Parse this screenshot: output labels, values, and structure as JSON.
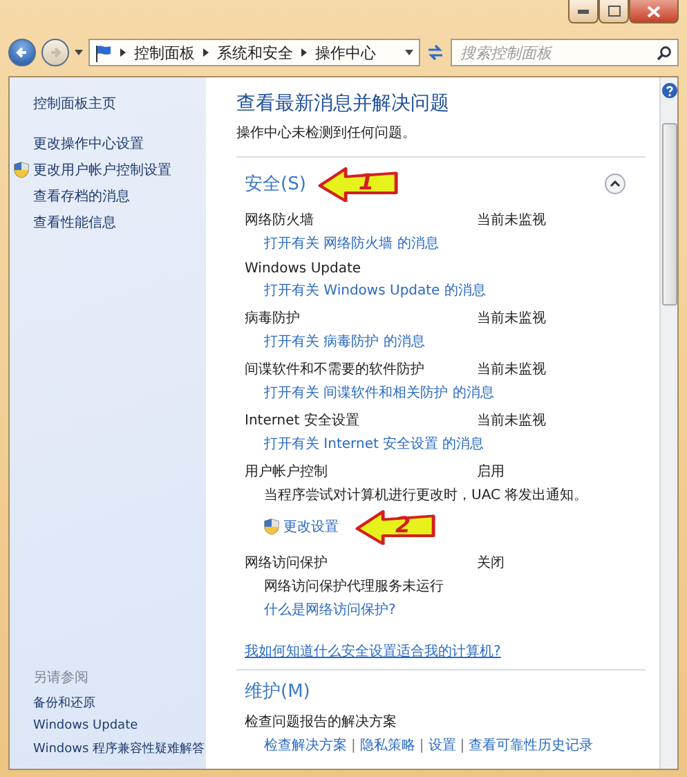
{
  "address_bar": {
    "breadcrumbs": [
      "控制面板",
      "系统和安全",
      "操作中心"
    ]
  },
  "search": {
    "placeholder": "搜索控制面板"
  },
  "sidebar": {
    "items": [
      {
        "label": "控制面板主页",
        "kind": "link"
      },
      {
        "label": "更改操作中心设置",
        "kind": "link"
      },
      {
        "label": "更改用户帐户控制设置",
        "kind": "shield"
      },
      {
        "label": "查看存档的消息",
        "kind": "link"
      },
      {
        "label": "查看性能信息",
        "kind": "link"
      }
    ],
    "see_also": {
      "title": "另请参阅",
      "items": [
        "备份和还原",
        "Windows Update",
        "Windows 程序兼容性疑难解答"
      ]
    }
  },
  "main": {
    "title": "查看最新消息并解决问题",
    "subtitle": "操作中心未检测到任何问题。",
    "security": {
      "title": "安全(S)",
      "expanded": true,
      "callout": "1",
      "items": [
        {
          "name": "网络防火墙",
          "status": "当前未监视",
          "lines": [
            {
              "kind": "link",
              "text": "打开有关 网络防火墙 的消息"
            }
          ]
        },
        {
          "name": "Windows Update",
          "lines": [
            {
              "kind": "link",
              "text": "打开有关 Windows Update 的消息"
            }
          ]
        },
        {
          "name": "病毒防护",
          "status": "当前未监视",
          "lines": [
            {
              "kind": "link",
              "text": "打开有关 病毒防护 的消息"
            }
          ]
        },
        {
          "name": "间谍软件和不需要的软件防护",
          "status": "当前未监视",
          "lines": [
            {
              "kind": "link",
              "text": "打开有关 间谍软件和相关防护 的消息"
            }
          ]
        },
        {
          "name": "Internet 安全设置",
          "status": "当前未监视",
          "lines": [
            {
              "kind": "link",
              "text": "打开有关 Internet 安全设置 的消息"
            }
          ]
        },
        {
          "name": "用户帐户控制",
          "status": "启用",
          "lines": [
            {
              "kind": "text",
              "text": "当程序尝试对计算机进行更改时，UAC 将发出通知。"
            },
            {
              "kind": "shield_link",
              "text": "更改设置",
              "callout": "2"
            }
          ]
        },
        {
          "name": "网络访问保护",
          "status": "关闭",
          "lines": [
            {
              "kind": "text",
              "text": "网络访问保护代理服务未运行"
            },
            {
              "kind": "link",
              "text": "什么是网络访问保护?"
            }
          ]
        }
      ],
      "question": "我如何知道什么安全设置适合我的计算机?"
    },
    "maintenance": {
      "title": "维护(M)",
      "item": "检查问题报告的解决方案",
      "links": [
        "检查解决方案",
        "隐私策略",
        "设置",
        "查看可靠性历史记录"
      ],
      "separator": "|"
    }
  }
}
